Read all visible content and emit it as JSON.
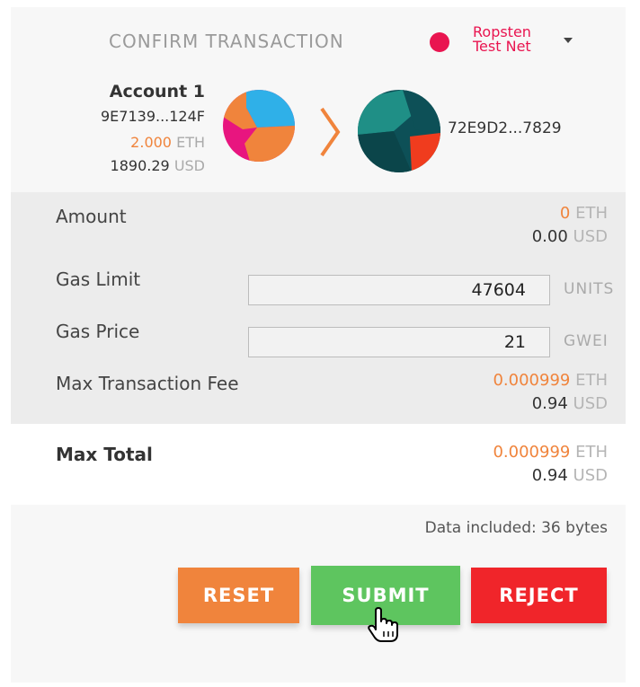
{
  "header": {
    "title": "CONFIRM TRANSACTION",
    "network": {
      "line1": "Ropsten",
      "line2": "Test Net",
      "color": "#e91550"
    }
  },
  "from": {
    "name": "Account 1",
    "address": "9E7139...124F",
    "balance_value": "2.000",
    "balance_unit": "ETH",
    "usd_value": "1890.29",
    "usd_unit": "USD"
  },
  "to": {
    "address": "72E9D2...7829"
  },
  "details": {
    "amount": {
      "label": "Amount",
      "eth": "0",
      "eth_unit": "ETH",
      "usd": "0.00",
      "usd_unit": "USD"
    },
    "gas_limit": {
      "label": "Gas Limit",
      "value": "47604",
      "unit": "UNITS"
    },
    "gas_price": {
      "label": "Gas Price",
      "value": "21",
      "unit": "GWEI"
    },
    "max_fee": {
      "label": "Max Transaction Fee",
      "eth": "0.000999",
      "eth_unit": "ETH",
      "usd": "0.94",
      "usd_unit": "USD"
    }
  },
  "total": {
    "label": "Max Total",
    "eth": "0.000999",
    "eth_unit": "ETH",
    "usd": "0.94",
    "usd_unit": "USD"
  },
  "data_included": "Data included: 36 bytes",
  "buttons": {
    "reset": "RESET",
    "submit": "SUBMIT",
    "reject": "REJECT"
  },
  "colors": {
    "accent_orange": "#f0843c",
    "submit_green": "#5ec55f",
    "reject_red": "#f0252a"
  }
}
